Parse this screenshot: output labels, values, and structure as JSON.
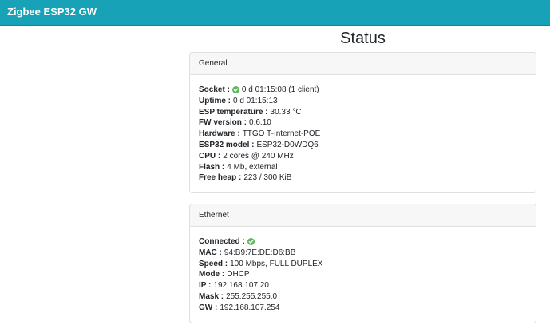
{
  "app": {
    "title": "Zigbee ESP32 GW"
  },
  "page": {
    "title": "Status"
  },
  "general": {
    "header": "General",
    "socket": {
      "label": "Socket :",
      "value": "0 d 01:15:08 (1 client)",
      "icon": "check-circle-icon"
    },
    "uptime": {
      "label": "Uptime :",
      "value": "0 d 01:15:13"
    },
    "esp_temperature": {
      "label": "ESP temperature :",
      "value": "30.33 °C"
    },
    "fw_version": {
      "label": "FW version :",
      "value": "0.6.10"
    },
    "hardware": {
      "label": "Hardware :",
      "value": "TTGO T-Internet-POE"
    },
    "esp32_model": {
      "label": "ESP32 model :",
      "value": "ESP32-D0WDQ6"
    },
    "cpu": {
      "label": "CPU :",
      "value": "2 cores @ 240 MHz"
    },
    "flash": {
      "label": "Flash :",
      "value": "4 Mb, external"
    },
    "free_heap": {
      "label": "Free heap :",
      "value": "223 / 300 KiB"
    }
  },
  "ethernet": {
    "header": "Ethernet",
    "connected": {
      "label": "Connected :",
      "icon": "check-circle-icon"
    },
    "mac": {
      "label": "MAC :",
      "value": "94:B9:7E:DE:D6:BB"
    },
    "speed": {
      "label": "Speed :",
      "value": "100 Mbps, FULL DUPLEX"
    },
    "mode": {
      "label": "Mode :",
      "value": "DHCP"
    },
    "ip": {
      "label": "IP :",
      "value": "192.168.107.20"
    },
    "mask": {
      "label": "Mask :",
      "value": "255.255.255.0"
    },
    "gw": {
      "label": "GW :",
      "value": "192.168.107.254"
    }
  },
  "colors": {
    "navbar": "#17a2b8",
    "ok": "#5cb85c",
    "card_header_bg": "#f7f7f7",
    "border": "#dfdfdf"
  }
}
